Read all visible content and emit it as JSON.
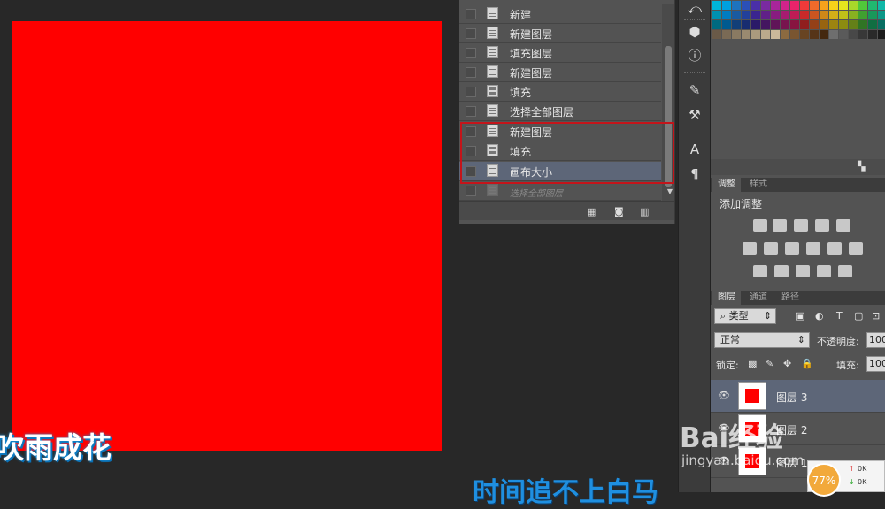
{
  "canvas": {
    "fill_color": "#ff0000"
  },
  "subtitles": {
    "left": "吹雨成花",
    "bottom": "时间追不上白马"
  },
  "history": {
    "items": [
      {
        "label": "新建",
        "icon": "document-icon"
      },
      {
        "label": "新建图层",
        "icon": "document-icon"
      },
      {
        "label": "填充图层",
        "icon": "document-icon"
      },
      {
        "label": "新建图层",
        "icon": "document-icon"
      },
      {
        "label": "填充",
        "icon": "fill-icon"
      },
      {
        "label": "选择全部图层",
        "icon": "document-icon"
      },
      {
        "label": "新建图层",
        "icon": "document-icon"
      },
      {
        "label": "填充",
        "icon": "fill-icon"
      },
      {
        "label": "画布大小",
        "icon": "document-icon",
        "selected": true
      },
      {
        "label": "选择全部图层",
        "icon": "document-icon",
        "dimmed": true
      }
    ],
    "highlight_color": "#c4141a"
  },
  "adjustments": {
    "tabs": [
      "调整",
      "样式"
    ],
    "title": "添加调整"
  },
  "layers": {
    "tabs": [
      "图层",
      "通道",
      "路径"
    ],
    "filter_kind": "类型",
    "blend_mode": "正常",
    "opacity_label": "不透明度:",
    "opacity_value": "100",
    "lock_label": "锁定:",
    "fill_label": "填充:",
    "fill_value": "100",
    "items": [
      {
        "name": "图层 3",
        "selected": true
      },
      {
        "name": "图层 2"
      },
      {
        "name": "图层 1"
      }
    ]
  },
  "watermark": {
    "brand": "Bai经验",
    "url": "jingyan.baidu.com"
  },
  "net_widget": {
    "percent": "77%",
    "up": "0K",
    "down": "0K"
  },
  "colors": {
    "selection": "#5d6678",
    "panel": "#535353",
    "accent_subtitle": "#1f8fe0"
  }
}
